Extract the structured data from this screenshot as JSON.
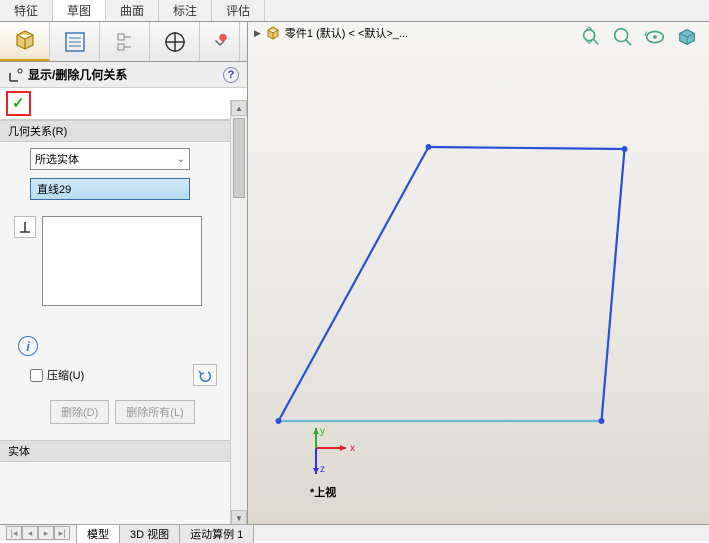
{
  "main_tabs": [
    "特征",
    "草图",
    "曲面",
    "标注",
    "评估"
  ],
  "main_tab_active": 1,
  "prop_header_title": "显示/删除几何关系",
  "section_relations_title": "几何关系(R)",
  "filter_selected": "所选实体",
  "selected_entity": "直线29",
  "suppress_label": "压缩(U)",
  "delete_label": "删除(D)",
  "delete_all_label": "删除所有(L)",
  "section_entities_title": "实体",
  "doc_name": "零件1 (默认) < <默认>_...",
  "view_name": "*上视",
  "bottom_tabs": [
    "模型",
    "3D 视图",
    "运动算例 1"
  ],
  "bottom_tab_active": 0,
  "colors": {
    "sketch_line": "#2a4fd8",
    "sketch_selected": "#6bb8d8",
    "highlight_border": "#e22"
  }
}
